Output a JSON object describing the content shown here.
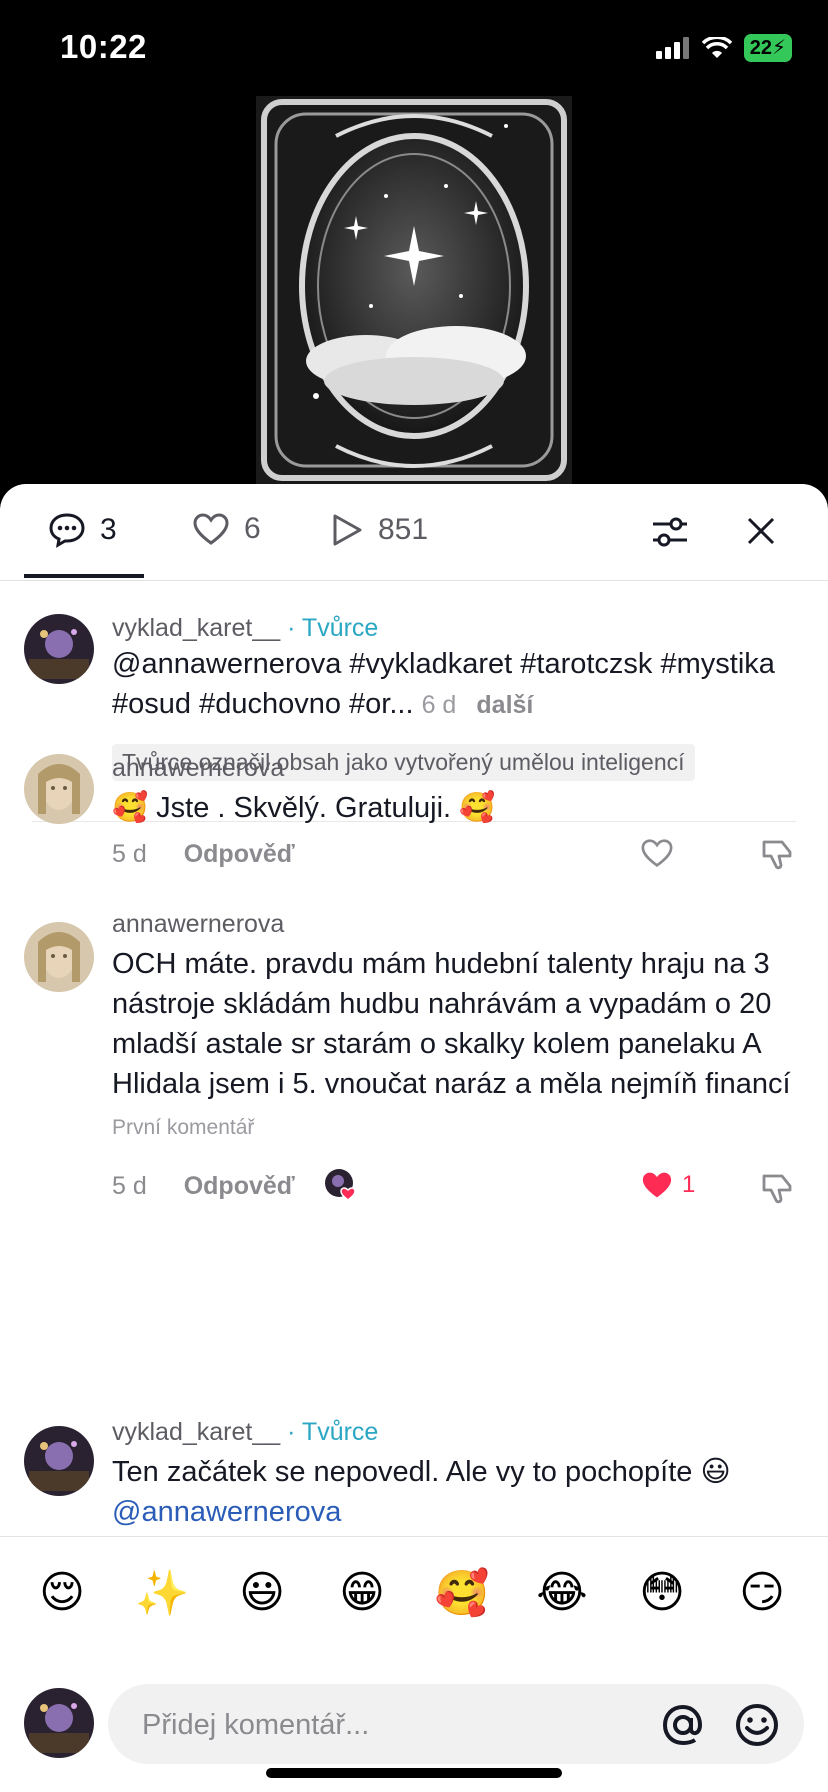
{
  "status": {
    "time": "10:22",
    "battery": "22"
  },
  "tabs": {
    "comments_count": "3",
    "likes_count": "6",
    "views_count": "851"
  },
  "comments": [
    {
      "username": "vyklad_karet__",
      "creator_label": "· Tvůrce",
      "text": "@annawernerova #vykladkaret #tarotczsk #mystika #osud #duchovno #or...",
      "age": "6 d",
      "more": "další",
      "ai_note": "Tvůrce označil obsah jako vytvořený umělou inteligencí"
    },
    {
      "username": "annawernerova",
      "text": "🥰 Jste . Skvělý. Gratuluji. 🥰",
      "age": "5 d",
      "reply": "Odpověď"
    },
    {
      "username": "annawernerova",
      "text": "OCH máte. pravdu mám hudební talenty hraju na 3 nástroje skládám hudbu nahrávám a vypadám o 20 mladší astale sr starám o skalky kolem panelaku A Hlidala jsem i 5. vnoučat naráz a měla nejmíň financí",
      "label": "První komentář",
      "age": "5 d",
      "reply": "Odpověď",
      "likes": "1"
    },
    {
      "username": "vyklad_karet__",
      "creator_label": "· Tvůrce",
      "text": "Ten začátek se nepovedl. Ale vy to pochopíte 😃",
      "mention": "@annawernerova"
    }
  ],
  "emoji_bar": [
    "😌",
    "✨",
    "😃",
    "😁",
    "🥰",
    "😂",
    "😳",
    "😏"
  ],
  "input": {
    "placeholder": "Přidej komentář..."
  },
  "colors": {
    "accent": "#fe2c55",
    "creator": "#2aa7c3",
    "mention": "#2b5db8"
  }
}
